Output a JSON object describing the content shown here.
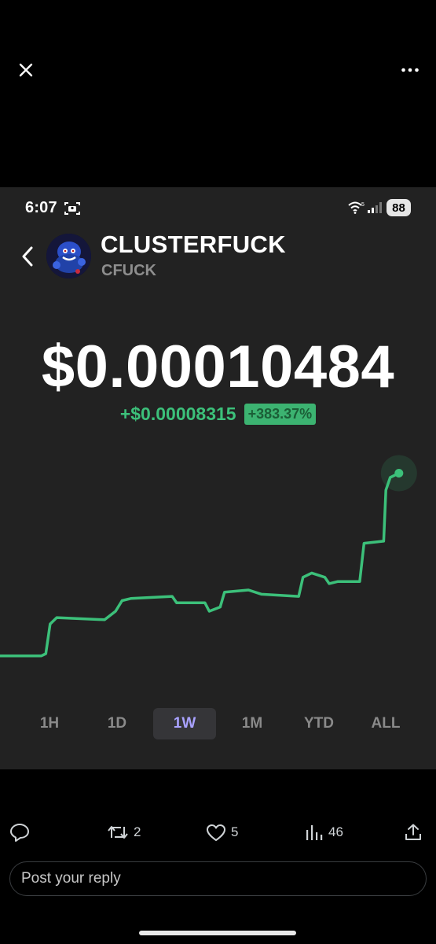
{
  "viewer": {
    "close_icon": "close-icon",
    "more_icon": "more-horizontal-icon"
  },
  "status_bar": {
    "time": "6:07",
    "battery": "88",
    "icons": [
      "screen-record-icon",
      "wifi-icon",
      "cellular-signal-icon"
    ]
  },
  "token": {
    "name": "CLUSTERFUCK",
    "ticker": "CFUCK",
    "price": "$0.00010484",
    "change_abs": "+$0.00008315",
    "change_pct": "+383.37%"
  },
  "colors": {
    "positive": "#3cc07a",
    "active_tab": "#a9a2ff",
    "panel_bg": "#222222"
  },
  "chart_data": {
    "type": "line",
    "x_range": [
      0,
      100
    ],
    "ylim": [
      0,
      100
    ],
    "grid": false,
    "series": [
      {
        "values": [
          [
            0,
            9
          ],
          [
            9.5,
            9
          ],
          [
            10.5,
            10
          ],
          [
            11.5,
            24
          ],
          [
            13,
            27
          ],
          [
            24,
            26
          ],
          [
            26.5,
            30
          ],
          [
            28,
            35
          ],
          [
            30,
            36
          ],
          [
            39.5,
            37
          ],
          [
            40.5,
            34
          ],
          [
            47,
            34
          ],
          [
            48,
            30
          ],
          [
            50.5,
            32
          ],
          [
            51.5,
            39
          ],
          [
            57,
            40
          ],
          [
            60,
            38
          ],
          [
            68.5,
            37
          ],
          [
            69.5,
            46
          ],
          [
            71.5,
            48
          ],
          [
            74.5,
            46
          ],
          [
            75.5,
            43
          ],
          [
            77.5,
            44
          ],
          [
            82.5,
            44
          ],
          [
            83.5,
            62
          ],
          [
            88,
            63
          ],
          [
            88.5,
            87
          ],
          [
            89.5,
            93
          ],
          [
            91.5,
            95
          ]
        ]
      }
    ]
  },
  "timeframes": {
    "items": [
      "1H",
      "1D",
      "1W",
      "1M",
      "YTD",
      "ALL"
    ],
    "selected": "1W"
  },
  "post_actions": {
    "reply_icon": "reply-icon",
    "repost_count": "2",
    "like_count": "5",
    "views_count": "46",
    "share_icon": "share-icon"
  },
  "reply_box": {
    "placeholder": "Post your reply"
  }
}
